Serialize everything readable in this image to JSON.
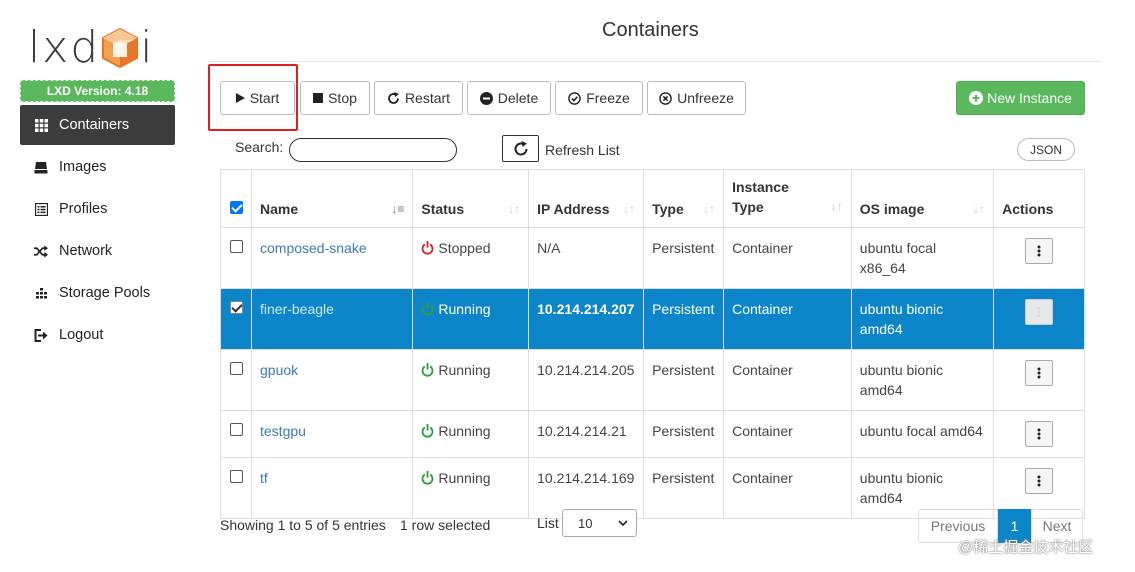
{
  "app": {
    "logo_text_left": "lxd",
    "logo_text_right": "i",
    "version_badge": "LXD Version: 4.18"
  },
  "sidebar": {
    "items": [
      {
        "label": "Containers",
        "icon": "grid-icon",
        "active": true
      },
      {
        "label": "Images",
        "icon": "drive-icon",
        "active": false
      },
      {
        "label": "Profiles",
        "icon": "list-icon",
        "active": false
      },
      {
        "label": "Network",
        "icon": "shuffle-icon",
        "active": false
      },
      {
        "label": "Storage Pools",
        "icon": "database-icon",
        "active": false
      },
      {
        "label": "Logout",
        "icon": "logout-icon",
        "active": false
      }
    ]
  },
  "header": {
    "title": "Containers"
  },
  "toolbar": {
    "start": "Start",
    "stop": "Stop",
    "restart": "Restart",
    "delete": "Delete",
    "freeze": "Freeze",
    "unfreeze": "Unfreeze",
    "new_instance": "New Instance"
  },
  "search": {
    "label": "Search:",
    "value": "",
    "refresh_label": "Refresh List",
    "json_label": "JSON"
  },
  "table": {
    "columns": [
      "Name",
      "Status",
      "IP Address",
      "Type",
      "Instance Type",
      "OS image",
      "Actions"
    ],
    "rows": [
      {
        "name": "composed-snake",
        "status": "Stopped",
        "ip": "N/A",
        "type": "Persistent",
        "instance_type": "Container",
        "os": "ubuntu focal x86_64",
        "checked": false,
        "selected": false
      },
      {
        "name": "finer-beagle",
        "status": "Running",
        "ip": "10.214.214.207",
        "type": "Persistent",
        "instance_type": "Container",
        "os": "ubuntu bionic amd64",
        "checked": true,
        "selected": true
      },
      {
        "name": "gpuok",
        "status": "Running",
        "ip": "10.214.214.205",
        "type": "Persistent",
        "instance_type": "Container",
        "os": "ubuntu bionic amd64",
        "checked": false,
        "selected": false
      },
      {
        "name": "testgpu",
        "status": "Running",
        "ip": "10.214.214.21",
        "type": "Persistent",
        "instance_type": "Container",
        "os": "ubuntu focal amd64",
        "checked": false,
        "selected": false
      },
      {
        "name": "tf",
        "status": "Running",
        "ip": "10.214.214.169",
        "type": "Persistent",
        "instance_type": "Container",
        "os": "ubuntu bionic amd64",
        "checked": false,
        "selected": false
      }
    ]
  },
  "footer": {
    "showing": "Showing 1 to 5 of 5 entries",
    "selected_info": "1 row selected",
    "list_label": "List",
    "list_value": "10",
    "prev": "Previous",
    "page": "1",
    "next": "Next"
  },
  "watermark": "@稀土掘金技术社区",
  "colors": {
    "accent_blue": "#0c86c8",
    "success_green": "#5cb85c",
    "stopped_red": "#d9231d",
    "running_green": "#2e9b3e",
    "highlight_red": "#e02020"
  }
}
